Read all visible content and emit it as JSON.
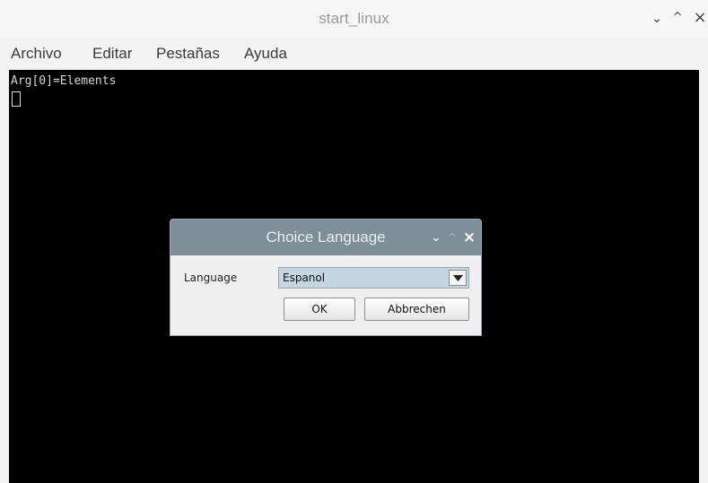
{
  "window": {
    "title": "start_linux",
    "controls": {
      "minimize": "⌄",
      "maximize": "^",
      "close": "×"
    }
  },
  "menu": [
    "Archivo",
    "Editar",
    "Pestañas",
    "Ayuda"
  ],
  "terminal": {
    "lines": [
      "Arg[0]=Elements"
    ]
  },
  "dialog": {
    "title": "Choice Language",
    "controls": {
      "minimize": "⌄",
      "maximize": "^",
      "close": "×"
    },
    "language_label": "Language",
    "language_value": "Espanol",
    "ok_label": "OK",
    "cancel_label": "Abbrechen"
  },
  "colors": {
    "terminal_bg": "#000000",
    "dialog_titlebar": "#7f8f98",
    "select_bg": "#c4d6e2"
  }
}
